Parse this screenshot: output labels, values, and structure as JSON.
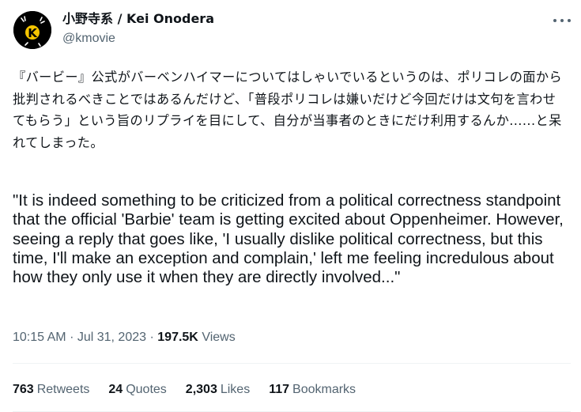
{
  "author": {
    "display_name": "小野寺系 / Kei Onodera",
    "handle": "@kmovie",
    "avatar_text": "K"
  },
  "tweet": {
    "text_ja": "『バービー』公式がバーベンハイマーについてはしゃいでいるというのは、ポリコレの面から批判されるべきことではあるんだけど、「普段ポリコレは嫌いだけど今回だけは文句を言わせてもらう」という旨のリプライを目にして、自分が当事者のときにだけ利用するんか......と呆れてしまった。",
    "text_en": "\"It is indeed something to be criticized from a political correctness standpoint that the official 'Barbie' team is getting excited about Oppenheimer. However, seeing a reply that goes like, 'I usually dislike political correctness, but this time, I'll make an exception and complain,' left me feeling incredulous about how they only use it when they are directly involved...\""
  },
  "meta": {
    "time": "10:15 AM",
    "separator": "·",
    "date": "Jul 31, 2023",
    "views_count": "197.5K",
    "views_label": "Views"
  },
  "stats": {
    "retweets": {
      "count": "763",
      "label": "Retweets"
    },
    "quotes": {
      "count": "24",
      "label": "Quotes"
    },
    "likes": {
      "count": "2,303",
      "label": "Likes"
    },
    "bookmarks": {
      "count": "117",
      "label": "Bookmarks"
    }
  },
  "colors": {
    "text_primary": "#0f1419",
    "text_secondary": "#536471",
    "divider": "#eff3f4",
    "avatar_bg": "#000000",
    "avatar_accent": "#f5c400"
  },
  "icons": {
    "more": "more-horizontal-icon"
  }
}
